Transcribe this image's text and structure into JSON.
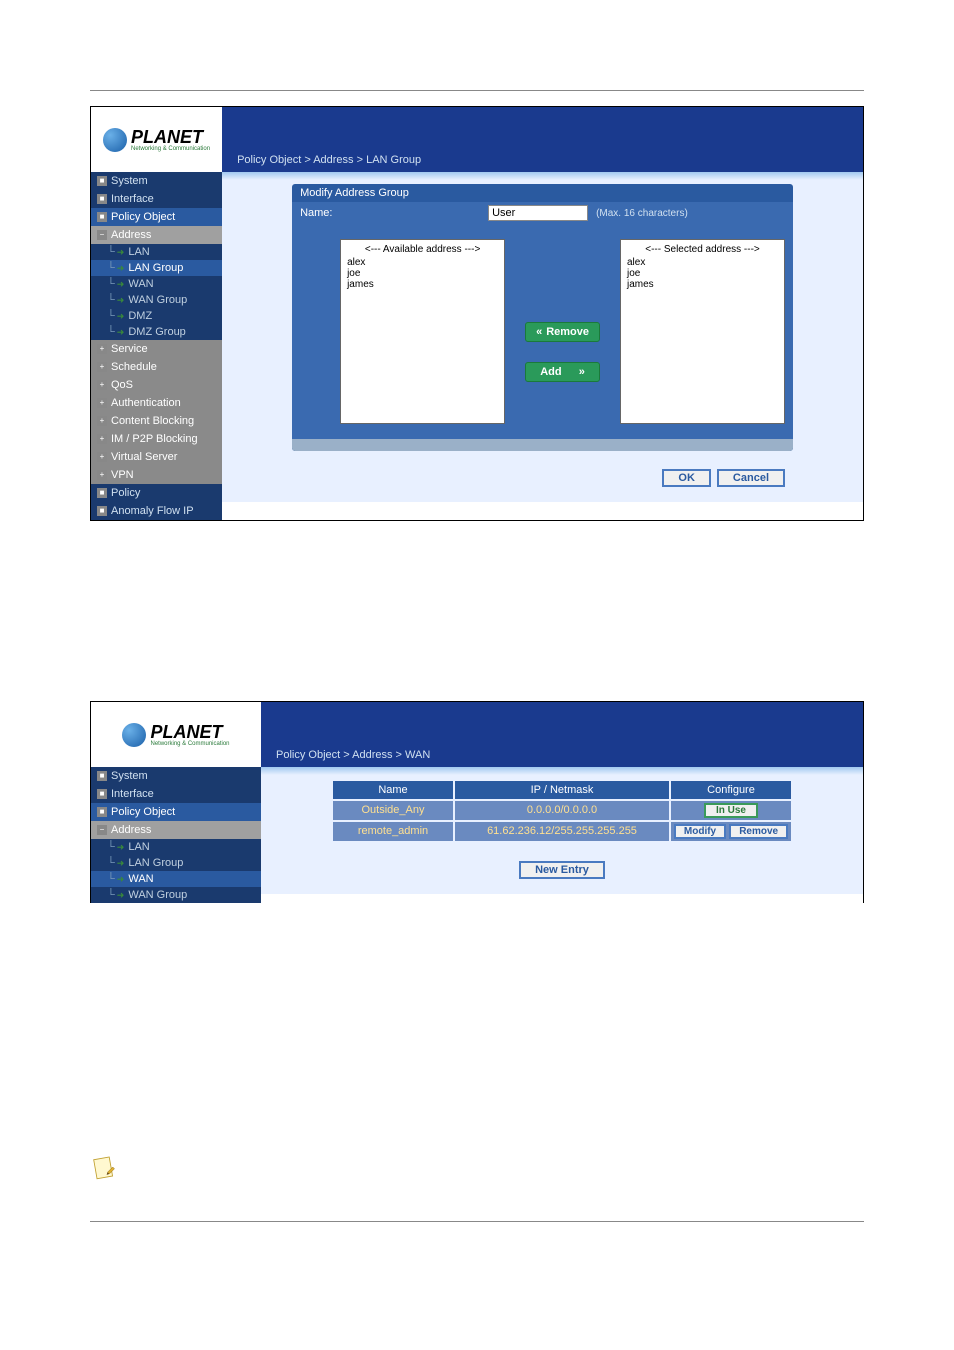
{
  "logo": {
    "brand": "PLANET",
    "tagline": "Networking & Communication"
  },
  "screenshot1": {
    "breadcrumb": "Policy Object > Address > LAN Group",
    "nav": {
      "h1": "System",
      "h2": "Interface",
      "h3": "Policy Object",
      "group_address": "Address",
      "sub": {
        "lan": "LAN",
        "lan_group": "LAN Group",
        "wan": "WAN",
        "wan_group": "WAN Group",
        "dmz": "DMZ",
        "dmz_group": "DMZ Group"
      },
      "group_service": "Service",
      "group_schedule": "Schedule",
      "group_qos": "QoS",
      "group_auth": "Authentication",
      "group_content": "Content Blocking",
      "group_imp2p": "IM / P2P Blocking",
      "group_virtual": "Virtual Server",
      "group_vpn": "VPN",
      "h4": "Policy",
      "h5": "Anomaly Flow IP"
    },
    "form": {
      "title": "Modify Address Group",
      "name_label": "Name:",
      "name_value": "User",
      "name_hint": "(Max. 16 characters)",
      "available_head": "<--- Available address --->",
      "selected_head": "<--- Selected address --->",
      "available": [
        "alex",
        "joe",
        "james"
      ],
      "selected": [
        "alex",
        "joe",
        "james"
      ],
      "btn_remove": "Remove",
      "btn_add": "Add"
    },
    "btn_ok": "OK",
    "btn_cancel": "Cancel"
  },
  "screenshot2": {
    "breadcrumb": "Policy Object > Address > WAN",
    "nav": {
      "h1": "System",
      "h2": "Interface",
      "h3": "Policy Object",
      "group_address": "Address",
      "sub": {
        "lan": "LAN",
        "lan_group": "LAN Group",
        "wan": "WAN",
        "wan_group": "WAN Group"
      }
    },
    "table": {
      "col_name": "Name",
      "col_ip": "IP / Netmask",
      "col_cfg": "Configure",
      "rows": [
        {
          "name": "Outside_Any",
          "ip": "0.0.0.0/0.0.0.0",
          "cfg": "inuse"
        },
        {
          "name": "remote_admin",
          "ip": "61.62.236.12/255.255.255.255",
          "cfg": "modrem"
        }
      ],
      "btn_inuse": "In Use",
      "btn_modify": "Modify",
      "btn_remove": "Remove",
      "btn_new": "New Entry"
    }
  }
}
